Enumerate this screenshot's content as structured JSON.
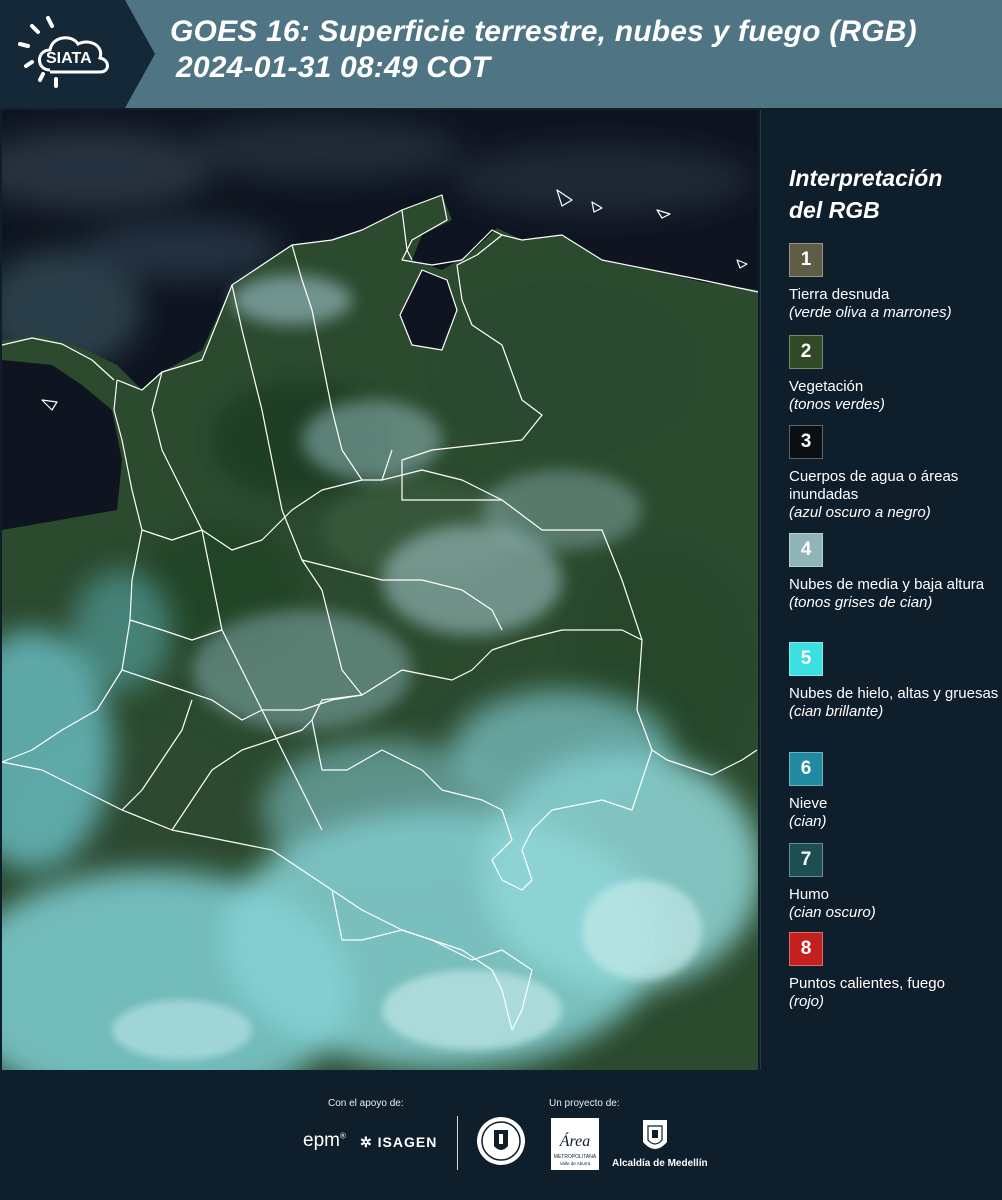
{
  "header": {
    "logo_text": "SIATA",
    "title_line1": "GOES 16: Superficie terrestre, nubes y fuego (RGB)",
    "title_line2": "2024-01-31 08:49 COT",
    "background_color": "#4f7585",
    "logo_background_color": "#152838"
  },
  "legend": {
    "title_line1": "Interpretación",
    "title_line2": "del RGB",
    "items": [
      {
        "number": "1",
        "label": "Tierra desnuda",
        "description": "(verde oliva a marrones)",
        "color": "#5e5c44"
      },
      {
        "number": "2",
        "label": "Vegetación",
        "description": "(tonos verdes)",
        "color": "#2f4a24"
      },
      {
        "number": "3",
        "label": "Cuerpos de agua o áreas inundadas",
        "description": "(azul oscuro a negro)",
        "color": "#0a0f14"
      },
      {
        "number": "4",
        "label": "Nubes de media y baja altura",
        "description": "(tonos grises de cian)",
        "color": "#8fb5b8"
      },
      {
        "number": "5",
        "label": "Nubes de hielo, altas y gruesas",
        "description": "(cian brillante)",
        "color": "#3de0e0"
      },
      {
        "number": "6",
        "label": "Nieve",
        "description": "(cian)",
        "color": "#1f8aa0"
      },
      {
        "number": "7",
        "label": "Humo",
        "description": "(cian oscuro)",
        "color": "#1d4e52"
      },
      {
        "number": "8",
        "label": "Puntos calientes, fuego",
        "description": "(rojo)",
        "color": "#c42020"
      }
    ]
  },
  "map": {
    "region": "Colombia",
    "palette": {
      "ocean": "#0e1520",
      "vegetation": "#2a4a2c",
      "cloud_low": "#8ab8bc",
      "cloud_ice": "#6fd7dc",
      "border": "#ffffff"
    }
  },
  "footer": {
    "support_label": "Con el apoyo de:",
    "project_label": "Un proyecto de:",
    "sponsor_epm": "epm",
    "sponsor_isagen": "ISAGEN",
    "area_logo_text": "Área",
    "area_logo_sub": "METROPOLITANA",
    "area_logo_sub2": "Valle de Aburrá",
    "alcaldia_text": "Alcaldía de Medellín"
  }
}
